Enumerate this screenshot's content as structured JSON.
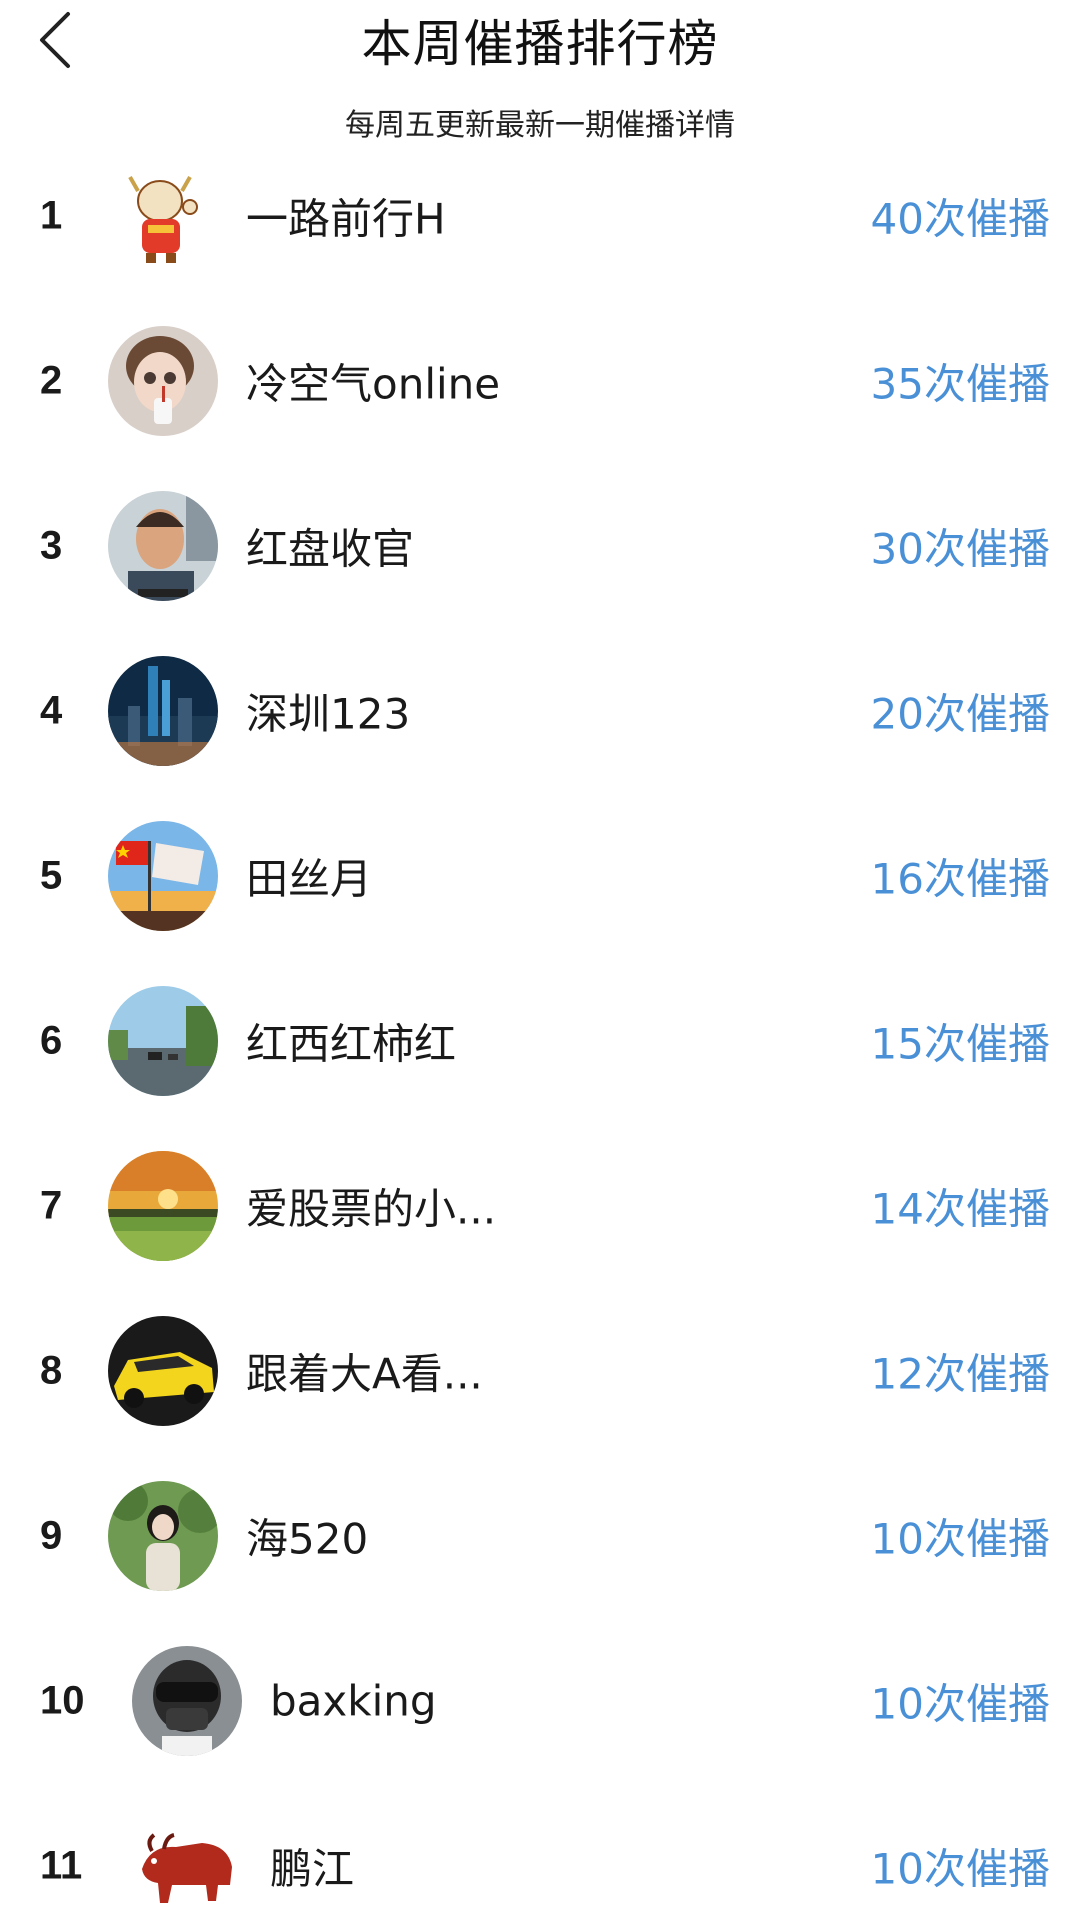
{
  "header": {
    "back_icon": "chevron-left-icon",
    "title": "本周催播排行榜",
    "subtitle": "每周五更新最新一期催播详情"
  },
  "colors": {
    "accent": "#4a90d6",
    "text": "#1a1a1a",
    "background": "#ffffff"
  },
  "ranking": [
    {
      "rank": "1",
      "name": "一路前行H",
      "count": "40次催播",
      "avatar": "ox-mascot-avatar"
    },
    {
      "rank": "2",
      "name": "冷空气online",
      "count": "35次催播",
      "avatar": "doll-avatar"
    },
    {
      "rank": "3",
      "name": "红盘收官",
      "count": "30次催播",
      "avatar": "man-portrait-avatar"
    },
    {
      "rank": "4",
      "name": "深圳123",
      "count": "20次催播",
      "avatar": "city-night-avatar"
    },
    {
      "rank": "5",
      "name": "田丝月",
      "count": "16次催播",
      "avatar": "flag-avatar"
    },
    {
      "rank": "6",
      "name": "红西红柿红",
      "count": "15次催播",
      "avatar": "road-avatar"
    },
    {
      "rank": "7",
      "name": "爱股票的小...",
      "count": "14次催播",
      "avatar": "sunset-field-avatar"
    },
    {
      "rank": "8",
      "name": "跟着大A看...",
      "count": "12次催播",
      "avatar": "yellow-car-avatar"
    },
    {
      "rank": "9",
      "name": "海520",
      "count": "10次催播",
      "avatar": "girl-greenery-avatar"
    },
    {
      "rank": "10",
      "name": "baxking",
      "count": "10次催播",
      "avatar": "helmet-avatar"
    },
    {
      "rank": "11",
      "name": "鹏江",
      "count": "10次催播",
      "avatar": "bull-avatar"
    }
  ]
}
